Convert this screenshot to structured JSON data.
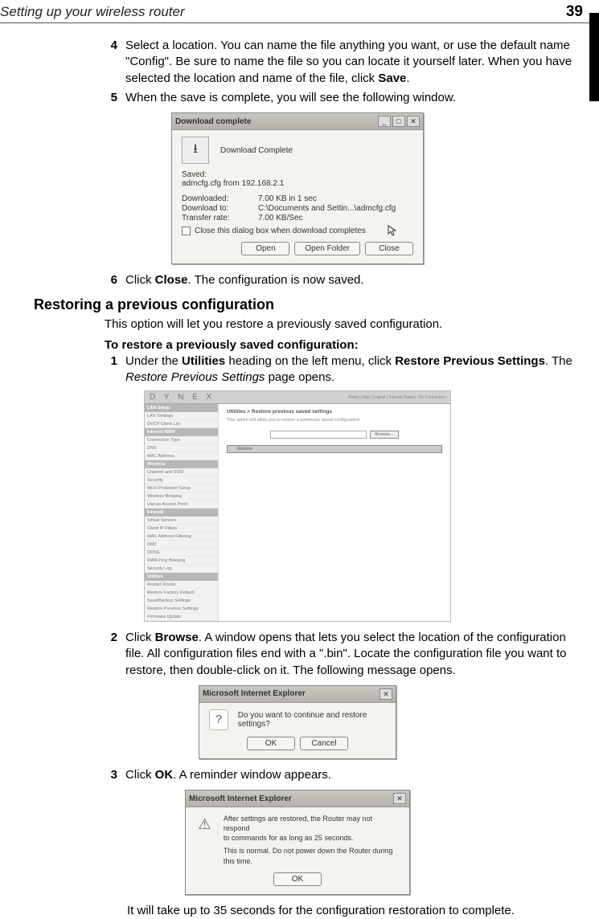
{
  "header": {
    "title": "Setting up your wireless router",
    "page_number": "39"
  },
  "steps_a": [
    {
      "num": "4",
      "text_before": "Select a location. You can name the file anything you want, or use the default name \"Config\". Be sure to name the file so you can locate it yourself later. When you have selected the location and name of the file, click ",
      "bold": "Save",
      "text_after": "."
    },
    {
      "num": "5",
      "text_before": "When the save is complete, you will see the following window.",
      "bold": "",
      "text_after": ""
    }
  ],
  "dl_dialog": {
    "title": "Download complete",
    "heading": "Download Complete",
    "saved_label": "Saved:",
    "saved_value": "admcfg.cfg from 192.168.2.1",
    "rows": [
      {
        "k": "Downloaded:",
        "v": "7.00 KB in 1 sec"
      },
      {
        "k": "Download to:",
        "v": "C:\\Documents and Settin...\\admcfg.cfg"
      },
      {
        "k": "Transfer rate:",
        "v": "7.00 KB/Sec"
      }
    ],
    "checkbox_label": "Close this dialog box when download completes",
    "buttons": {
      "open": "Open",
      "open_folder": "Open Folder",
      "close": "Close"
    }
  },
  "step6": {
    "num": "6",
    "pre": "Click ",
    "bold": "Close",
    "post": ". The configuration is now saved."
  },
  "section2": {
    "heading": "Restoring a previous configuration",
    "intro": "This option will let you restore a previously saved configuration.",
    "proc_heading": "To restore a previously saved configuration:"
  },
  "step_b1": {
    "num": "1",
    "p1": "Under the ",
    "b1": "Utilities",
    "p2": " heading on the left menu, click ",
    "b2": "Restore Previous Settings",
    "p3": ". The ",
    "i1": "Restore Previous Settings",
    "p4": " page opens."
  },
  "router": {
    "brand": "D Y N E X",
    "toplinks": "Home | Help | Logout | Internet Status:",
    "status_link": "No Connection",
    "crumbs": "Utilities > Restore previous saved settings",
    "desc": "This option will allow you to restore a previously saved configuration.",
    "browse": "Browse...",
    "restore": "Restore",
    "nav_sections": [
      {
        "head": "LAN Setup",
        "items": [
          "LAN Settings",
          "DHCP Client List"
        ]
      },
      {
        "head": "Internet WAN",
        "items": [
          "Connection Type",
          "DNS",
          "MAC Address"
        ]
      },
      {
        "head": "Wireless",
        "items": [
          "Channel and SSID",
          "Security",
          "Wi-Fi Protected Setup",
          "Wireless Bridging",
          "Use as Access Point"
        ]
      },
      {
        "head": "Firewall",
        "items": [
          "Virtual Servers",
          "Client IP Filters",
          "MAC Address Filtering",
          "DMZ",
          "DDNS",
          "WAN Ping Blocking",
          "Security Log"
        ]
      },
      {
        "head": "Utilities",
        "items": [
          "Restart Router",
          "Restore Factory Default",
          "Save/Backup Settings",
          "Restore Previous Settings",
          "Firmware Update"
        ]
      }
    ]
  },
  "step_b2": {
    "num": "2",
    "p1": "Click ",
    "b1": "Browse",
    "p2": ". A window opens that lets you select the location of the configuration file. All configuration files end with a \".bin\". Locate the configuration file you want to restore, then double-click on it. The following message opens."
  },
  "msie1": {
    "title": "Microsoft Internet Explorer",
    "msg": "Do you want to continue and restore settings?",
    "ok": "OK",
    "cancel": "Cancel"
  },
  "step_b3": {
    "num": "3",
    "p1": "Click ",
    "b1": "OK",
    "p2": ". A reminder window appears."
  },
  "msie2": {
    "title": "Microsoft Internet Explorer",
    "line1": "After settings are restored, the Router may not respond",
    "line2": "to commands for as long as 25 seconds.",
    "line3": "This is normal. Do not power down the Router during this time.",
    "ok": "OK"
  },
  "closing": "It will take up to 35 seconds for the configuration restoration to complete."
}
